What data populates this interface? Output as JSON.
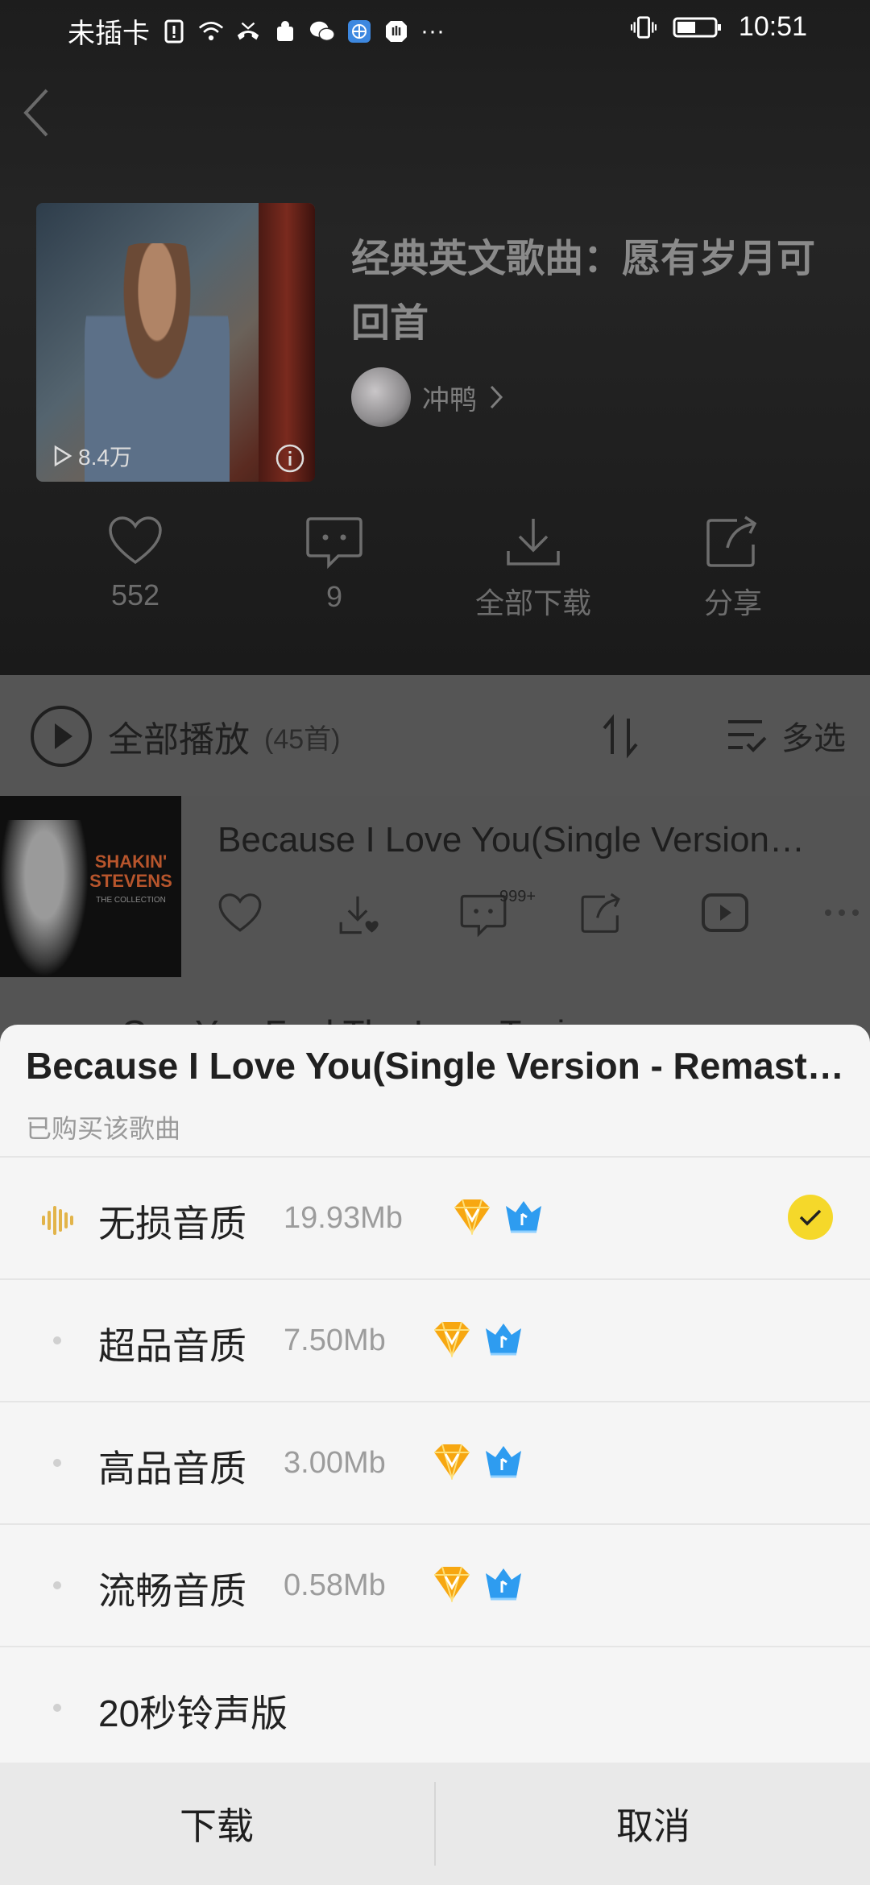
{
  "status_bar": {
    "carrier": "未插卡",
    "time": "10:51"
  },
  "header": {
    "playlist_title": "经典英文歌曲：愿有岁月可回首",
    "creator_name": "冲鸭",
    "play_count": "8.4万",
    "actions": [
      {
        "icon": "heart-icon",
        "label": "552"
      },
      {
        "icon": "comment-icon",
        "label": "9"
      },
      {
        "icon": "download-icon",
        "label": "全部下载"
      },
      {
        "icon": "share-icon",
        "label": "分享"
      }
    ]
  },
  "list": {
    "play_all_label": "全部播放",
    "play_all_count": "(45首)",
    "multi_select_label": "多选",
    "songs": [
      {
        "title": "Because I Love You(Single Version - Remastered)",
        "art_text_line1": "SHAKIN'",
        "art_text_line2": "STEVENS",
        "art_text_line3": "THE COLLECTION",
        "comment_badge": "999+"
      }
    ],
    "peek_next_title": "Can You Feel The Love Tonig"
  },
  "sheet": {
    "title": "Because I Love You(Single Version - Remastered)",
    "subtitle": "已购买该歌曲",
    "options": [
      {
        "label": "无损音质",
        "size": "19.93Mb",
        "badges": true,
        "selected": true
      },
      {
        "label": "超品音质",
        "size": "7.50Mb",
        "badges": true,
        "selected": false
      },
      {
        "label": "高品音质",
        "size": "3.00Mb",
        "badges": true,
        "selected": false
      },
      {
        "label": "流畅音质",
        "size": "0.58Mb",
        "badges": true,
        "selected": false
      },
      {
        "label": "20秒铃声版",
        "size": "",
        "badges": false,
        "selected": false
      }
    ],
    "download_label": "下载",
    "cancel_label": "取消"
  },
  "colors": {
    "accent_yellow": "#f5d82a",
    "wave_icon": "#e2b44a",
    "diamond_orange": "#f7a711",
    "crown_blue": "#2e9cf0"
  }
}
